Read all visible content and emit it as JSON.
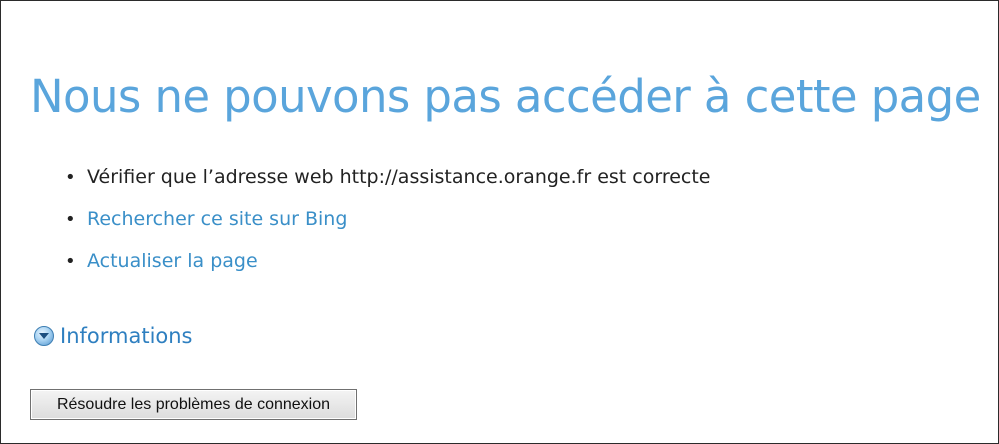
{
  "page": {
    "title": "Nous ne pouvons pas accéder à cette page"
  },
  "suggestions": [
    {
      "text": "Vérifier que l’adresse web http://assistance.orange.fr est correcte",
      "is_link": false
    },
    {
      "text": "Rechercher ce site sur Bing",
      "is_link": true
    },
    {
      "text": "Actualiser la page",
      "is_link": true
    }
  ],
  "details": {
    "label": "Informations",
    "icon": "chevron-down-circle-icon"
  },
  "actions": {
    "troubleshoot_label": "Résoudre les problèmes de connexion"
  },
  "colors": {
    "title": "#5aa5dc",
    "link": "#3a8fc8",
    "text": "#222222"
  }
}
